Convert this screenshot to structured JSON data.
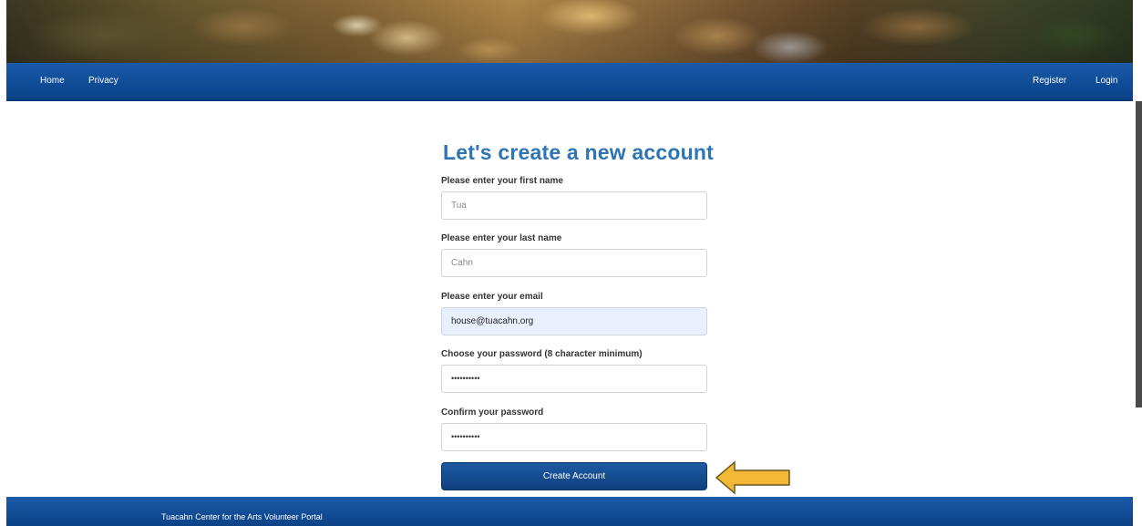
{
  "nav": {
    "left": [
      {
        "label": "Home"
      },
      {
        "label": "Privacy"
      }
    ],
    "right": [
      {
        "label": "Register"
      },
      {
        "label": "Login"
      }
    ]
  },
  "form": {
    "title": "Let's create a new account",
    "first_name": {
      "label": "Please enter your first name",
      "placeholder": "Tua"
    },
    "last_name": {
      "label": "Please enter your last name",
      "placeholder": "Cahn"
    },
    "email": {
      "label": "Please enter your email",
      "value": "house@tuacahn.org"
    },
    "password": {
      "label": "Choose your password (8 character minimum)",
      "value": "••••••••••"
    },
    "confirm_password": {
      "label": "Confirm your password",
      "value": "••••••••••"
    },
    "submit_label": "Create Account"
  },
  "footer": {
    "text": "Tuacahn Center for the Arts Volunteer Portal"
  },
  "colors": {
    "nav_blue": "#0f4b96",
    "title_blue": "#2e75b6",
    "arrow_fill": "#f1b735",
    "arrow_stroke": "#6b5a20",
    "autofill_bg": "#e8f0fe"
  },
  "icons": {
    "annotation": "left-arrow-icon"
  }
}
